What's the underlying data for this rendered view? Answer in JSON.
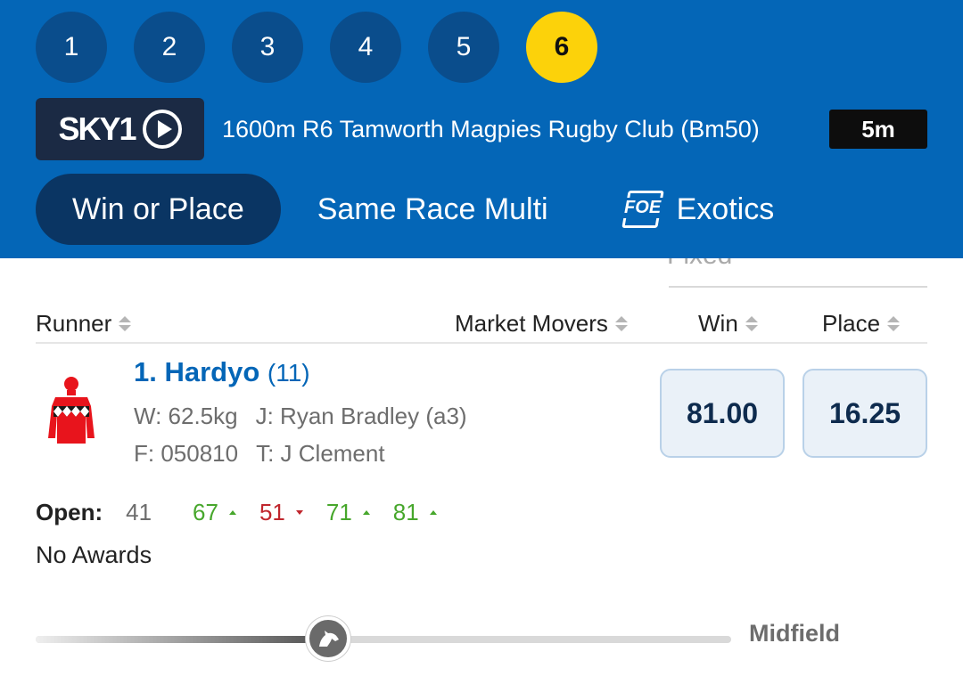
{
  "race_tabs": [
    {
      "label": "1",
      "active": false
    },
    {
      "label": "2",
      "active": false
    },
    {
      "label": "3",
      "active": false
    },
    {
      "label": "4",
      "active": false
    },
    {
      "label": "5",
      "active": false
    },
    {
      "label": "6",
      "active": true
    }
  ],
  "race_info": {
    "channel": "SKY1",
    "title": "1600m R6 Tamworth Magpies Rugby Club (Bm50)",
    "countdown": "5m"
  },
  "bet_tabs": [
    {
      "label": "Win or Place",
      "active": true
    },
    {
      "label": "Same Race Multi",
      "active": false
    },
    {
      "label": "Exotics",
      "active": false,
      "icon": "foe-icon",
      "icon_text": "FOE"
    }
  ],
  "fixed_peek": "Fixed",
  "columns": {
    "runner": "Runner",
    "market_movers": "Market Movers",
    "win": "Win",
    "place": "Place"
  },
  "runner": {
    "name": "1. Hardyo",
    "barrier": "(11)",
    "weight": "W: 62.5kg",
    "jockey": "J: Ryan Bradley (a3)",
    "form": "F: 050810",
    "trainer": "T: J Clement",
    "win_odds": "81.00",
    "place_odds": "16.25",
    "silks_colors": {
      "cap": "#e8141c",
      "body": "#e8141c",
      "diamonds": "#1a1a1a",
      "pattern": "#ffffff"
    }
  },
  "market": {
    "open_label": "Open:",
    "open_value": "41",
    "movements": [
      {
        "value": "67",
        "direction": "up"
      },
      {
        "value": "51",
        "direction": "down"
      },
      {
        "value": "71",
        "direction": "up"
      },
      {
        "value": "81",
        "direction": "up"
      }
    ]
  },
  "awards": "No Awards",
  "speed_map": {
    "label": "Midfield",
    "position_fraction": 0.42
  },
  "colors": {
    "header_blue": "#0466b7",
    "active_race": "#fcd20a",
    "up": "#47a72c",
    "down": "#c0262d"
  }
}
